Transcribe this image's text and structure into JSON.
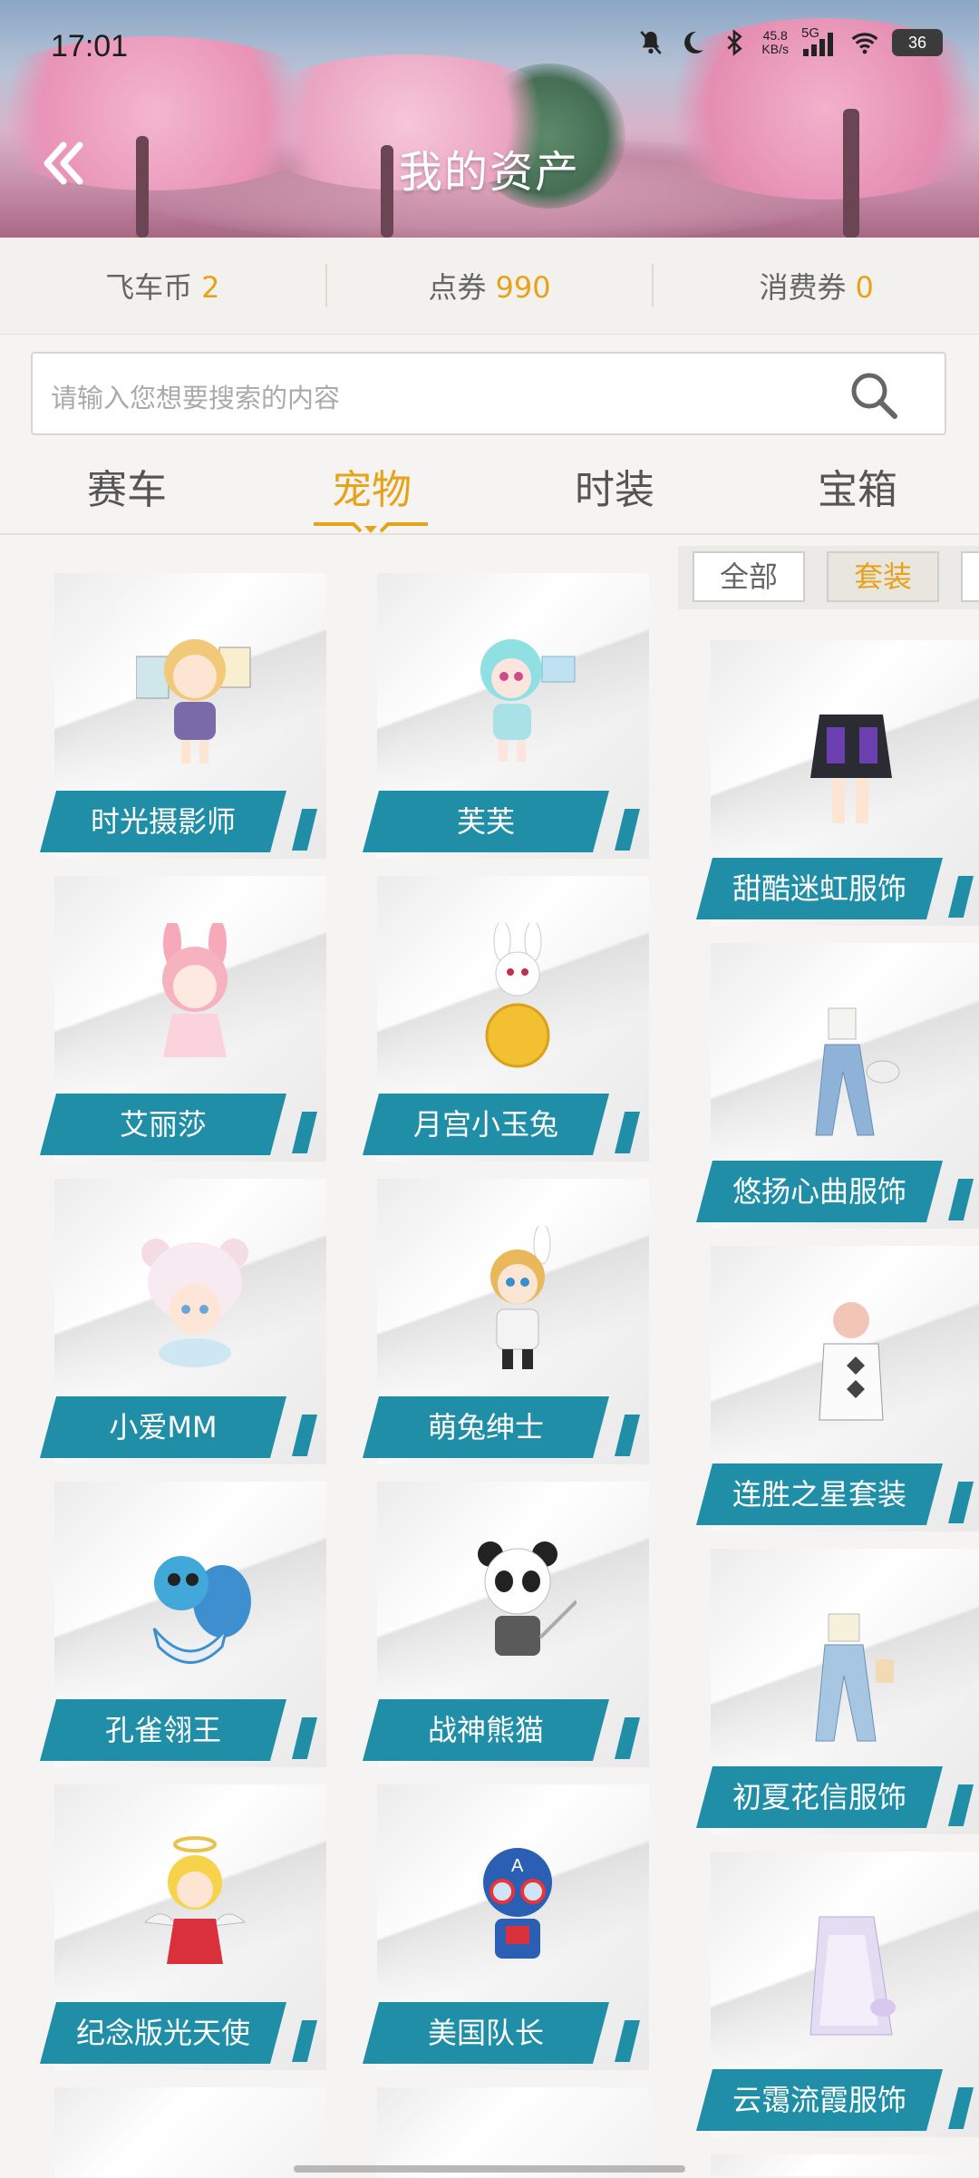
{
  "status_bar": {
    "time": "17:01",
    "net_speed_value": "45.8",
    "net_speed_unit": "KB/s",
    "network_type": "5G",
    "battery": "36",
    "icons": [
      "bell-muted-icon",
      "moon-icon",
      "bluetooth-icon",
      "signal-icon",
      "wifi-icon",
      "battery-icon"
    ]
  },
  "header": {
    "title": "我的资产",
    "back_icon": "double-chevron-left-icon"
  },
  "currency": [
    {
      "label": "飞车币",
      "value": "2"
    },
    {
      "label": "点券",
      "value": "990"
    },
    {
      "label": "消费券",
      "value": "0"
    }
  ],
  "search": {
    "placeholder": "请输入您想要搜索的内容",
    "icon": "search-icon"
  },
  "tabs": [
    {
      "label": "赛车",
      "active": false
    },
    {
      "label": "宠物",
      "active": true
    },
    {
      "label": "时装",
      "active": false
    },
    {
      "label": "宝箱",
      "active": false
    }
  ],
  "filters": [
    {
      "label": "全部",
      "active": false
    },
    {
      "label": "套装",
      "active": true
    }
  ],
  "pets_left": [
    {
      "name": "时光摄影师"
    },
    {
      "name": "艾丽莎"
    },
    {
      "name": "小爱MM"
    },
    {
      "name": "孔雀翎王"
    },
    {
      "name": "纪念版光天使"
    }
  ],
  "pets_middle": [
    {
      "name": "芙芙"
    },
    {
      "name": "月宫小玉兔"
    },
    {
      "name": "萌兔绅士"
    },
    {
      "name": "战神熊猫"
    },
    {
      "name": "美国队长"
    }
  ],
  "outfits_right": [
    {
      "name": "甜酷迷虹服饰"
    },
    {
      "name": "悠扬心曲服饰"
    },
    {
      "name": "连胜之星套装"
    },
    {
      "name": "初夏花信服饰"
    },
    {
      "name": "云霭流霞服饰"
    }
  ],
  "colors": {
    "accent": "#e8a21a",
    "label_bg": "#1f8ea6",
    "page_bg": "#f5f4f2"
  }
}
